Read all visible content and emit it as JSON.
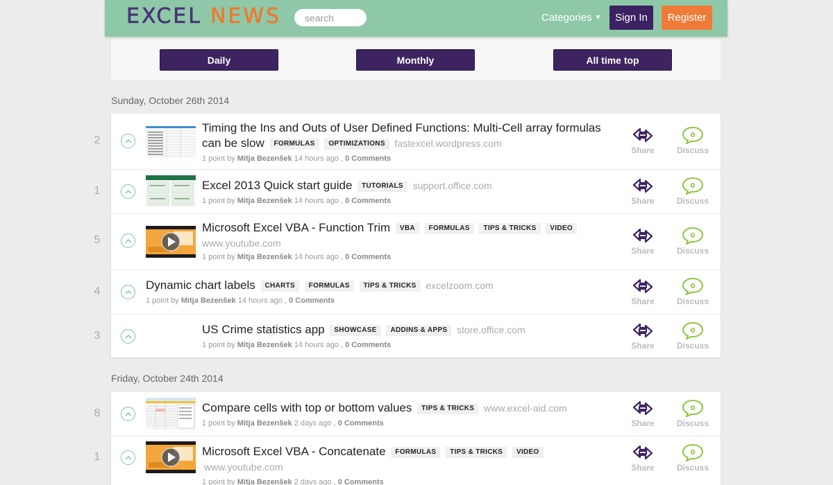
{
  "header": {
    "logo_part1": "EXCEL",
    "logo_part2": "NEWS",
    "search_placeholder": "search",
    "categories_label": "Categories",
    "signin_label": "Sign In",
    "register_label": "Register"
  },
  "filters": {
    "daily": "Daily",
    "monthly": "Monthly",
    "alltime": "All time top"
  },
  "actions": {
    "share": "Share",
    "discuss": "Discuss"
  },
  "sections": [
    {
      "date": "Sunday, October 26th 2014",
      "items": [
        {
          "rank": "2",
          "title_line1": "Timing the Ins and Outs of User Defined Functions: Multi-Cell array formulas",
          "title_line2": "can be slow",
          "tags": [
            "FORMULAS",
            "OPTIMIZATIONS"
          ],
          "domain": "fastexcel.wordpress.com",
          "points": "1 point by",
          "author": "Mitja Bezenšek",
          "time": "14 hours ago ,",
          "comments": "0 Comments"
        },
        {
          "rank": "1",
          "title": "Excel 2013 Quick start guide",
          "tags": [
            "TUTORIALS"
          ],
          "domain": "support.office.com",
          "points": "1 point by",
          "author": "Mitja Bezenšek",
          "time": "14 hours ago ,",
          "comments": "0 Comments"
        },
        {
          "rank": "5",
          "title": "Microsoft Excel VBA - Function Trim",
          "tags": [
            "VBA",
            "FORMULAS",
            "TIPS & TRICKS",
            "VIDEO"
          ],
          "domain": "www.youtube.com",
          "points": "1 point by",
          "author": "Mitja Bezenšek",
          "time": "14 hours ago ,",
          "comments": "0 Comments"
        },
        {
          "rank": "4",
          "title": "Dynamic chart labels",
          "tags": [
            "CHARTS",
            "FORMULAS",
            "TIPS & TRICKS"
          ],
          "domain": "excelzoom.com",
          "points": "1 point by",
          "author": "Mitja Bezenšek",
          "time": "14 hours ago ,",
          "comments": "0 Comments"
        },
        {
          "rank": "3",
          "title": "US Crime statistics app",
          "tags": [
            "SHOWCASE",
            "ADDINS & APPS"
          ],
          "domain": "store.office.com",
          "points": "1 point by",
          "author": "Mitja Bezenšek",
          "time": "14 hours ago ,",
          "comments": "0 Comments"
        }
      ]
    },
    {
      "date": "Friday, October 24th 2014",
      "items": [
        {
          "rank": "8",
          "title": "Compare cells with top or bottom values",
          "tags": [
            "TIPS & TRICKS"
          ],
          "domain": "www.excel-aid.com",
          "points": "1 point by",
          "author": "Mitja Bezenšek",
          "time": "2 days ago ,",
          "comments": "0 Comments"
        },
        {
          "rank": "1",
          "title": "Microsoft Excel VBA - Concatenate",
          "tags": [
            "FORMULAS",
            "TIPS & TRICKS",
            "VIDEO"
          ],
          "domain": "www.youtube.com",
          "points": "1 point by",
          "author": "Mitja Bezenšek",
          "time": "2 days ago ,",
          "comments": "0 Comments"
        }
      ]
    }
  ],
  "colors": {
    "header_bg": "#8fc8a8",
    "brand_purple": "#3d2461",
    "brand_orange": "#f07b38",
    "upvote_green": "#7cc49c",
    "discuss_green": "#8cc63f"
  }
}
